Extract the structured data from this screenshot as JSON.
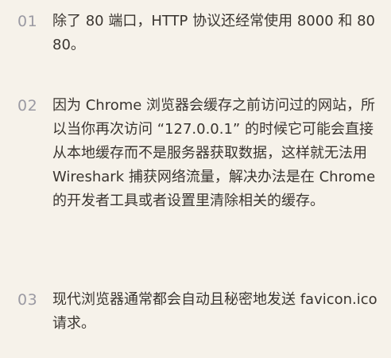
{
  "notes": [
    {
      "number": "01",
      "text": "除了 80 端口，HTTP 协议还经常使用 8000 和 8080。"
    },
    {
      "number": "02",
      "text": "因为 Chrome 浏览器会缓存之前访问过的网站，所以当你再次访问 “127.0.0.1” 的时候它可能会直接从本地缓存而不是服务器获取数据，这样就无法用 Wireshark 捕获网络流量，解决办法是在 Chrome 的开发者工具或者设置里清除相关的缓存。"
    },
    {
      "number": "03",
      "text": "现代浏览器通常都会自动且秘密地发送 favicon.ico 请求。"
    }
  ]
}
